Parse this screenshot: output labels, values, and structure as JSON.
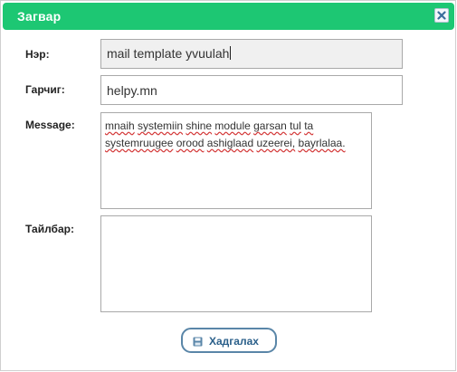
{
  "dialog": {
    "title": "Загвар",
    "close_icon": "close-icon"
  },
  "form": {
    "name_label": "Нэр:",
    "name_value": "mail template yvuulah",
    "subject_label": "Гарчиг:",
    "subject_value": "helpy.mn",
    "message_label": "Message:",
    "message_value": "mnaih systemiin shine module garsan tul ta systemruugee orood ashiglaad uzeerei, bayrlalaa.",
    "note_label": "Тайлбар:",
    "note_value": ""
  },
  "actions": {
    "save_label": "Хадгалах",
    "save_icon": "save-icon"
  },
  "colors": {
    "titlebar": "#1dc773",
    "button_border": "#5a86a8",
    "button_text": "#2a5f8a",
    "spellcheck_underline": "#d43a3a"
  }
}
